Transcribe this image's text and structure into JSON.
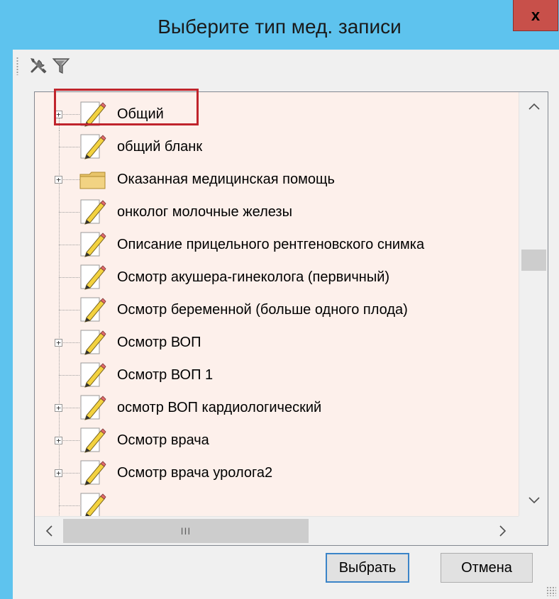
{
  "window": {
    "title": "Выберите тип мед. записи",
    "close_label": "x"
  },
  "toolbar": {
    "items": [
      {
        "icon": "tools-icon"
      },
      {
        "icon": "filter-icon"
      }
    ]
  },
  "tree": {
    "items": [
      {
        "label": "Общий",
        "icon": "pencil-document-icon",
        "expandable": true,
        "highlighted": true
      },
      {
        "label": "общий бланк",
        "icon": "pencil-document-icon",
        "expandable": false
      },
      {
        "label": "Оказанная медицинская помощь",
        "icon": "folder-icon",
        "expandable": true
      },
      {
        "label": "онколог молочные железы",
        "icon": "pencil-document-icon",
        "expandable": false
      },
      {
        "label": "Описание прицельного рентгеновского снимка",
        "icon": "pencil-document-icon",
        "expandable": false
      },
      {
        "label": "Осмотр акушера-гинеколога (первичный)",
        "icon": "pencil-document-icon",
        "expandable": false
      },
      {
        "label": "Осмотр беременной (больше одного плода)",
        "icon": "pencil-document-icon",
        "expandable": false
      },
      {
        "label": "Осмотр ВОП",
        "icon": "pencil-document-icon",
        "expandable": true
      },
      {
        "label": "Осмотр ВОП 1",
        "icon": "pencil-document-icon",
        "expandable": false
      },
      {
        "label": "осмотр ВОП кардиологический",
        "icon": "pencil-document-icon",
        "expandable": true
      },
      {
        "label": "Осмотр врача",
        "icon": "pencil-document-icon",
        "expandable": true
      },
      {
        "label": "Осмотр врача уролога2",
        "icon": "pencil-document-icon",
        "expandable": true
      },
      {
        "label": "",
        "icon": "pencil-document-icon",
        "expandable": false
      }
    ]
  },
  "scrollbars": {
    "vertical": {
      "up": "^",
      "down": "v"
    },
    "horizontal": {
      "left": "<",
      "right": ">",
      "thumb_grip": "III"
    }
  },
  "buttons": {
    "select_label": "Выбрать",
    "cancel_label": "Отмена"
  }
}
